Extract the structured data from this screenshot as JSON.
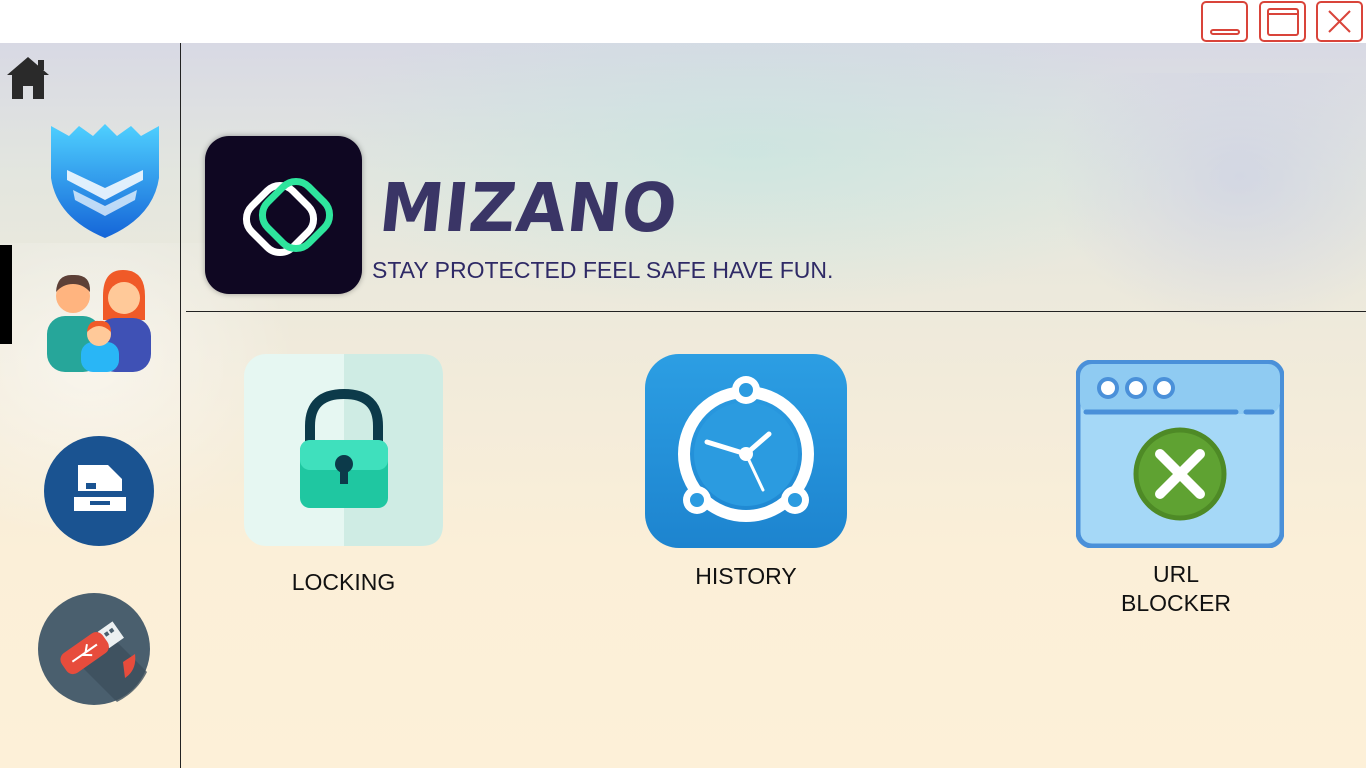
{
  "window_controls": {
    "minimize_icon": "minimize-icon",
    "maximize_icon": "maximize-icon",
    "close_icon": "close-icon",
    "accent_color": "#d9443a"
  },
  "sidebar": {
    "items": [
      {
        "id": "home",
        "icon": "home-icon"
      },
      {
        "id": "shield",
        "icon": "shield-icon"
      },
      {
        "id": "family",
        "icon": "family-icon",
        "active": true
      },
      {
        "id": "scanner",
        "icon": "scanner-icon"
      },
      {
        "id": "usb",
        "icon": "usb-drive-icon"
      }
    ]
  },
  "header": {
    "brand_name": "MIZANO",
    "tagline": "STAY PROTECTED FEEL SAFE HAVE FUN.",
    "logo_icon": "mizano-logo-icon",
    "brand_color": "#3a3566"
  },
  "features": [
    {
      "label": "LOCKING",
      "icon": "padlock-icon"
    },
    {
      "label": "HISTORY",
      "icon": "clock-icon"
    },
    {
      "label_line1": "URL",
      "label_line2": "BLOCKER",
      "icon": "url-blocker-icon"
    }
  ]
}
